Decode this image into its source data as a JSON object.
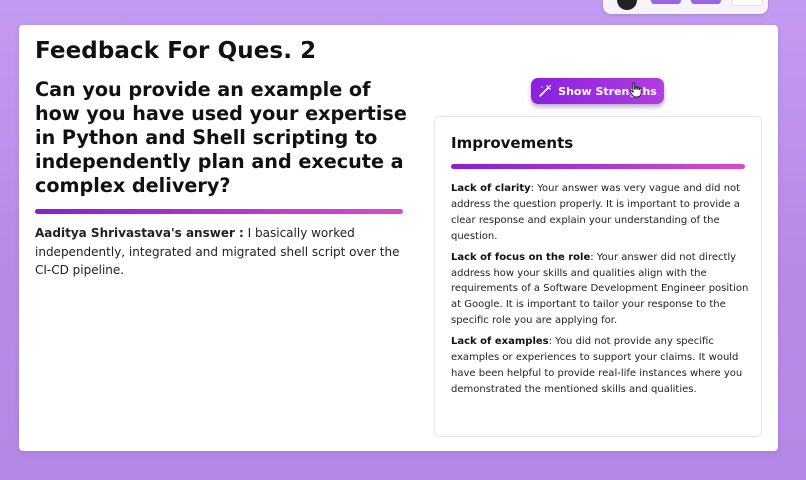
{
  "feedback": {
    "title": "Feedback For Ques. 2",
    "question": "Can you provide an example of how you have used your expertise in Python and Shell scripting to independently plan and execute a complex delivery?",
    "answer_author": "Aaditya Shrivastava's answer :",
    "answer_text": " I basically worked independently, integrated and migrated shell script over the CI-CD pipeline."
  },
  "actions": {
    "show_strengths_label": "Show Strengths"
  },
  "improvements": {
    "title": "Improvements",
    "items": [
      {
        "label": "Lack of clarity",
        "text": ": Your answer was very vague and did not address the question properly. It is important to provide a clear response and explain your understanding of the question."
      },
      {
        "label": "Lack of focus on the role",
        "text": ": Your answer did not directly address how your skills and qualities align with the requirements of a Software Development Engineer position at Google. It is important to tailor your response to the specific role you are applying for."
      },
      {
        "label": "Lack of examples",
        "text": ": You did not provide any specific examples or experiences to support your claims. It would have been helpful to provide real-life instances where you demonstrated the mentioned skills and qualities."
      }
    ]
  },
  "colors": {
    "accent": "#8a1fe0",
    "accent_light": "#d84bd0",
    "background": "#bf96ef"
  }
}
